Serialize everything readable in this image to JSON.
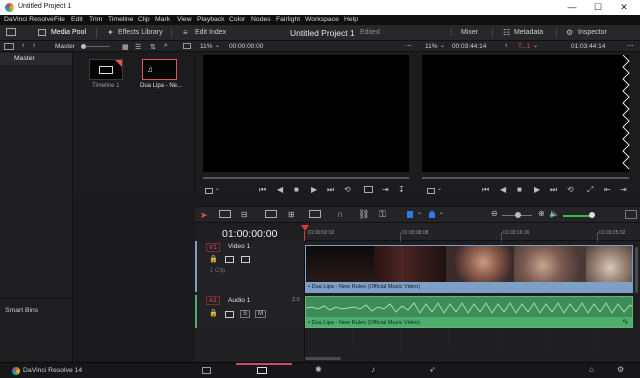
{
  "window": {
    "title": "Untitled Project 1",
    "minimize": "—",
    "maximize": "☐",
    "close": "✕"
  },
  "menu": [
    "DaVinci Resolve",
    "File",
    "Edit",
    "Trim",
    "Timeline",
    "Clip",
    "Mark",
    "View",
    "Playback",
    "Color",
    "Nodes",
    "Fairlight",
    "Workspace",
    "Help"
  ],
  "toolbar": {
    "media_pool": "Media Pool",
    "effects_library": "Effects Library",
    "edit_index": "Edit Index",
    "project_title": "Untitled Project 1",
    "edited": "Edited",
    "mixer": "Mixer",
    "metadata": "Metadata",
    "inspector": "Inspector"
  },
  "strip": {
    "master": "Master",
    "zoom_left": "11%",
    "timecode_left": "00:00:00:00",
    "zoom_right": "11%",
    "duration": "00:03:44:14",
    "timeline_name": "T...1",
    "timecode_right": "01:03:44:14"
  },
  "bins": {
    "master": "Master",
    "smart_bins": "Smart Bins"
  },
  "media": [
    {
      "label": "Timeline 1"
    },
    {
      "label": "Dua Lipa - Ne..."
    }
  ],
  "timeline": {
    "timecode": "01:00:00:00",
    "ruler": [
      "01:00:02:02",
      "01:00:38:08",
      "01:03:16:16",
      "01:03:25:02"
    ],
    "video_track": {
      "id": "V1",
      "name": "Video 1",
      "clips": "1 Clip"
    },
    "audio_track": {
      "id": "A1",
      "name": "Audio 1",
      "channels": "2.0",
      "s": "S",
      "m": "M"
    },
    "video_clip_label": "• Dua Lipa - New Rules (Official Music Video)",
    "audio_clip_label": "• Dua Lipa - New Rules (Official Music Video)"
  },
  "colors": {
    "video_clip": "#7ea0c7",
    "audio_clip": "#4fae6e",
    "playhead": "#e0383a",
    "accent_blue": "#2f7be5"
  },
  "footer": {
    "app": "DaVinci Resolve 14"
  }
}
